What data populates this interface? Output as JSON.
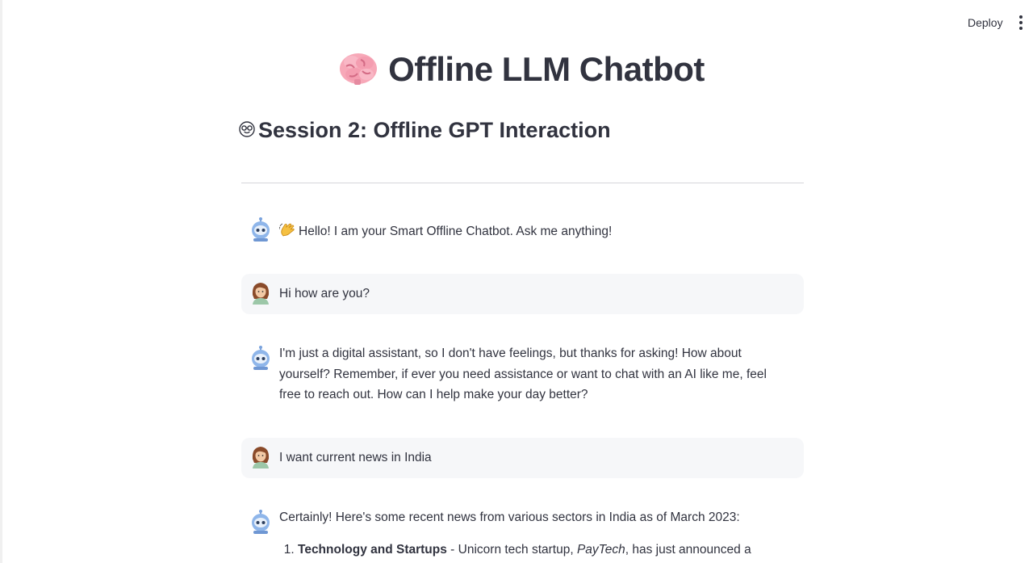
{
  "header": {
    "deploy_label": "Deploy",
    "menu_icon": "vertical-dots-icon"
  },
  "page": {
    "title": "Offline LLM Chatbot",
    "title_icon": "brain-emoji",
    "subtitle": "Session 2: Offline GPT Interaction",
    "subtitle_icon": "nerd-face-emoji"
  },
  "messages": [
    {
      "role": "assistant",
      "avatar": "robot-avatar-icon",
      "icon": "waving-hand-emoji",
      "text": "Hello! I am your Smart Offline Chatbot. Ask me anything!"
    },
    {
      "role": "user",
      "avatar": "user-avatar-icon",
      "text": "Hi how are you?"
    },
    {
      "role": "assistant",
      "avatar": "robot-avatar-icon",
      "text": "I'm just a digital assistant, so I don't have feelings, but thanks for asking! How about yourself? Remember, if ever you need assistance or want to chat with an AI like me, feel free to reach out. How can I help make your day better?"
    },
    {
      "role": "user",
      "avatar": "user-avatar-icon",
      "text": "I want current news in India"
    },
    {
      "role": "assistant",
      "avatar": "robot-avatar-icon",
      "text": "Certainly! Here's some recent news from various sectors in India as of March 2023:",
      "list": [
        {
          "heading": "Technology and Startups",
          "pre": " - Unicorn tech startup, ",
          "emph": "PayTech",
          "post": ", has just announced a record-"
        }
      ]
    }
  ],
  "colors": {
    "text": "#31333f",
    "user_bubble": "#f6f7f9",
    "divider": "#d6d6d9"
  }
}
